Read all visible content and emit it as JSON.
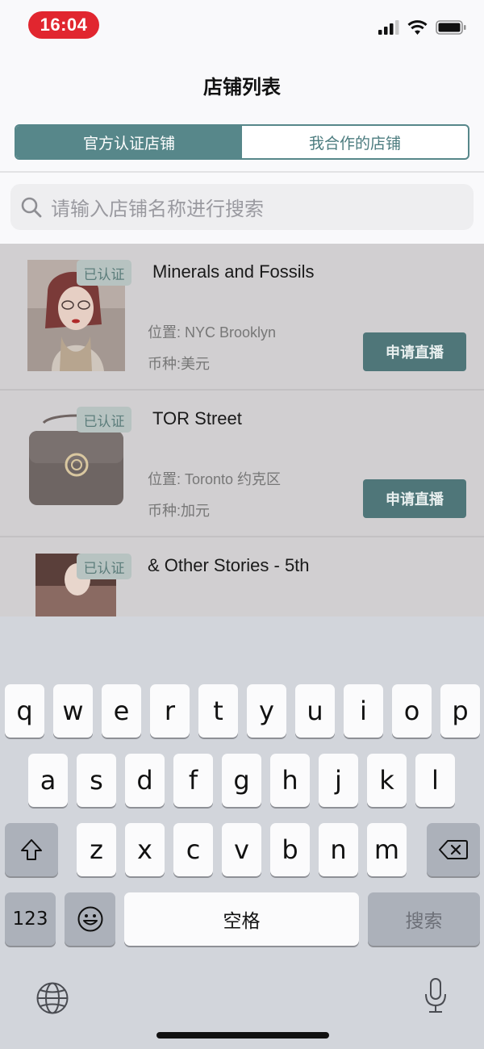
{
  "status_bar": {
    "time": "16:04",
    "icons": [
      "signal-icon",
      "wifi-icon",
      "battery-icon"
    ]
  },
  "nav": {
    "title": "店铺列表"
  },
  "tabs": [
    {
      "label": "官方认证店铺",
      "active": true
    },
    {
      "label": "我合作的店铺",
      "active": false
    }
  ],
  "search": {
    "placeholder": "请输入店铺名称进行搜索"
  },
  "stores": [
    {
      "name": "Minerals and Fossils",
      "badge": "已认证",
      "location": "位置: NYC Brooklyn",
      "currency": "币种:美元",
      "button": "申请直播"
    },
    {
      "name": "TOR Street",
      "badge": "已认证",
      "location": "位置: Toronto 约克区",
      "currency": "币种:加元",
      "button": "申请直播"
    },
    {
      "name": "& Other Stories - 5th",
      "badge": "已认证"
    }
  ],
  "keyboard": {
    "row1": [
      "q",
      "w",
      "e",
      "r",
      "t",
      "y",
      "u",
      "i",
      "o",
      "p"
    ],
    "row2": [
      "a",
      "s",
      "d",
      "f",
      "g",
      "h",
      "j",
      "k",
      "l"
    ],
    "row3": [
      "z",
      "x",
      "c",
      "v",
      "b",
      "n",
      "m"
    ],
    "numbers": "123",
    "space": "空格",
    "search": "搜索"
  },
  "colors": {
    "accent": "#57878a",
    "status_time": "#e1262f"
  }
}
